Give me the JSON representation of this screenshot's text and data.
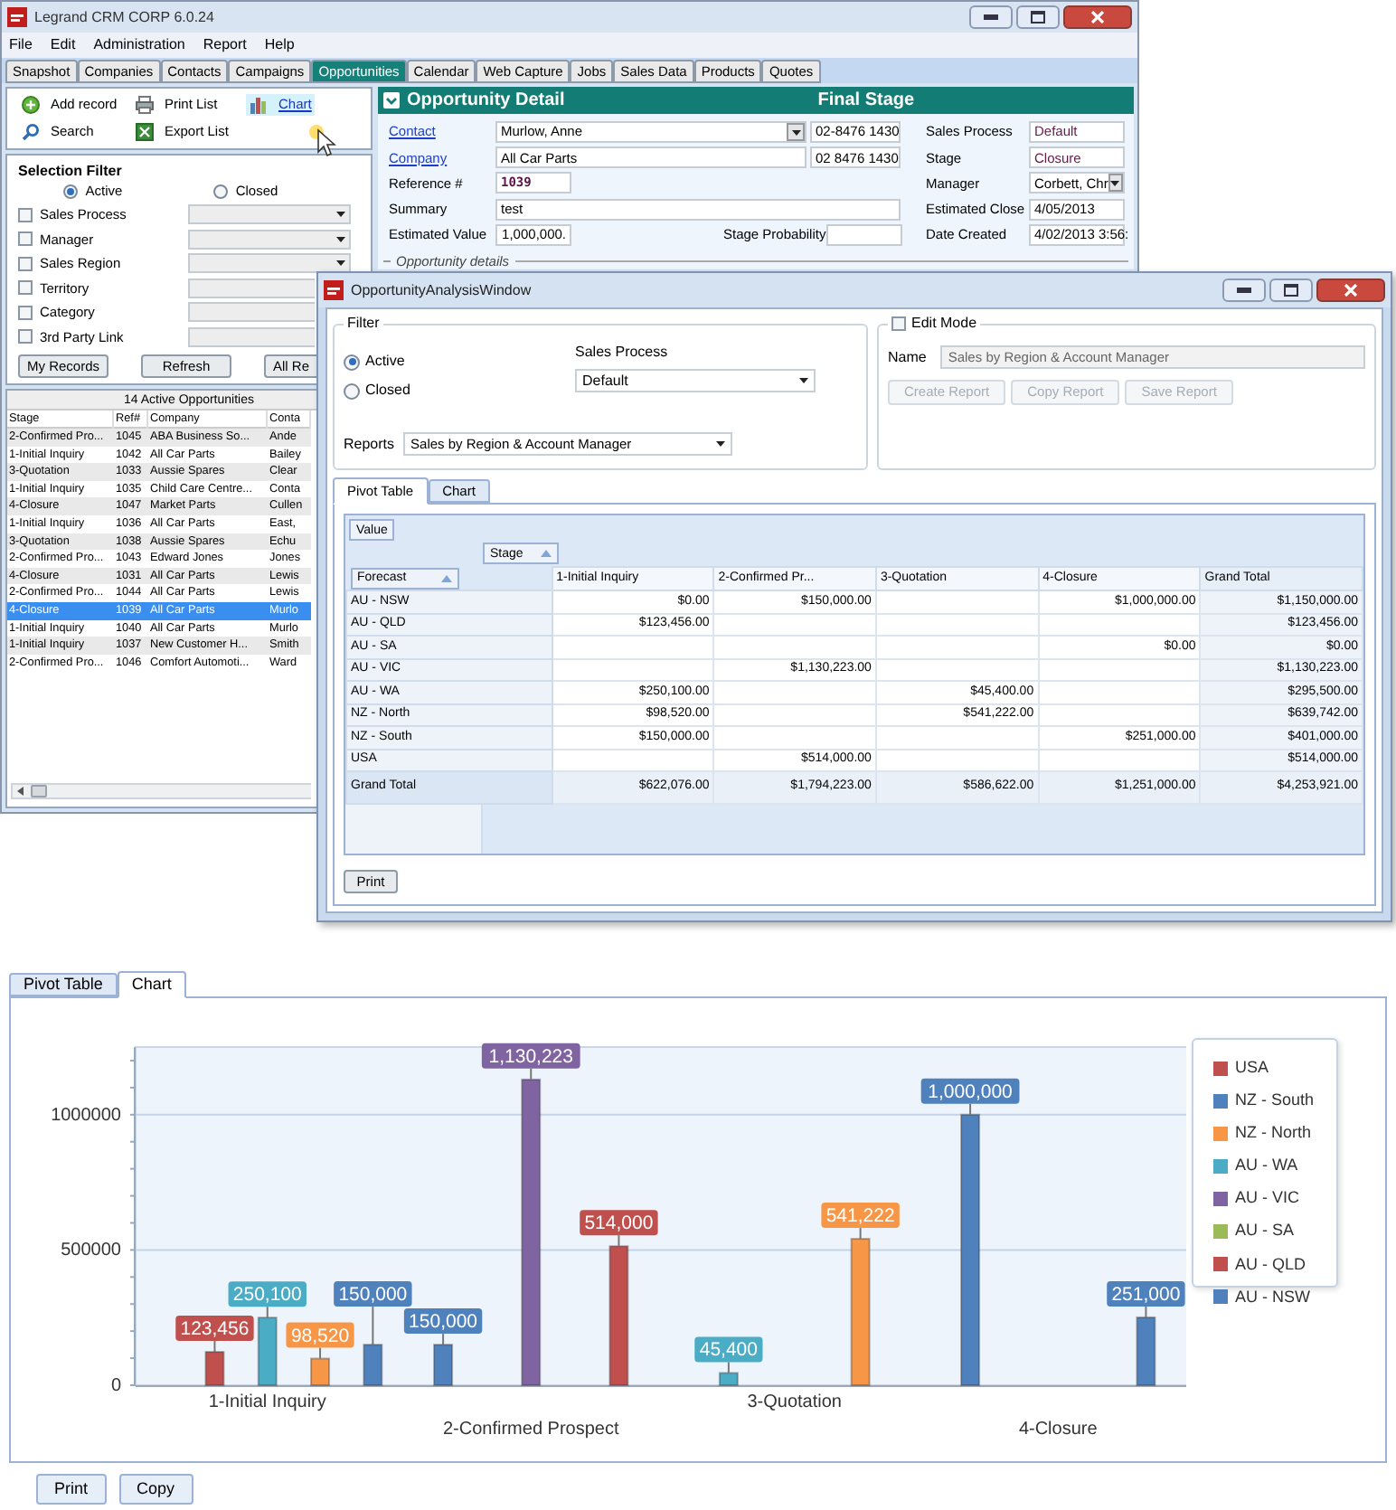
{
  "main_window": {
    "title": "Legrand CRM CORP 6.0.24",
    "menu": [
      "File",
      "Edit",
      "Administration",
      "Report",
      "Help"
    ],
    "tabs": [
      {
        "label": "Snapshot",
        "selected": false
      },
      {
        "label": "Companies",
        "selected": false
      },
      {
        "label": "Contacts",
        "selected": false
      },
      {
        "label": "Campaigns",
        "selected": false
      },
      {
        "label": "Opportunities",
        "selected": true
      },
      {
        "label": "Calendar",
        "selected": false
      },
      {
        "label": "Web Capture",
        "selected": false
      },
      {
        "label": "Jobs",
        "selected": false
      },
      {
        "label": "Sales Data",
        "selected": false
      },
      {
        "label": "Products",
        "selected": false
      },
      {
        "label": "Quotes",
        "selected": false
      }
    ],
    "actions": [
      {
        "label": "Add record",
        "kind": "add",
        "hovered": false
      },
      {
        "label": "Print List",
        "kind": "print",
        "hovered": false
      },
      {
        "label": "Chart",
        "kind": "chart",
        "hovered": true
      },
      {
        "label": "Search",
        "kind": "search",
        "hovered": false
      },
      {
        "label": "Export List",
        "kind": "export",
        "hovered": false
      }
    ],
    "selection_filter": {
      "title": "Selection Filter",
      "status_options": [
        {
          "label": "Active",
          "selected": true
        },
        {
          "label": "Closed",
          "selected": false
        }
      ],
      "filters": [
        {
          "label": "Sales Process",
          "checked": false,
          "kind": "dropdown"
        },
        {
          "label": "Manager",
          "checked": false,
          "kind": "dropdown"
        },
        {
          "label": "Sales Region",
          "checked": false,
          "kind": "dropdown"
        },
        {
          "label": "Territory",
          "checked": false,
          "kind": "text"
        },
        {
          "label": "Category",
          "checked": false,
          "kind": "text"
        },
        {
          "label": "3rd Party Link",
          "checked": false,
          "kind": "text"
        }
      ],
      "buttons": [
        "My Records",
        "Refresh",
        "All Re"
      ]
    },
    "list": {
      "title": "14 Active Opportunities",
      "columns": [
        "Stage",
        "Ref#",
        "Company",
        "Conta"
      ],
      "rows": [
        {
          "cells": [
            "2-Confirmed Pro...",
            "1045",
            "ABA Business So...",
            "Ande"
          ],
          "selected": false
        },
        {
          "cells": [
            "1-Initial Inquiry",
            "1042",
            "All Car Parts",
            "Bailey"
          ],
          "selected": false
        },
        {
          "cells": [
            "3-Quotation",
            "1033",
            "Aussie Spares",
            "Clear"
          ],
          "selected": false
        },
        {
          "cells": [
            "1-Initial Inquiry",
            "1035",
            "Child Care Centre...",
            "Conta"
          ],
          "selected": false
        },
        {
          "cells": [
            "4-Closure",
            "1047",
            "Market Parts",
            "Cullen"
          ],
          "selected": false
        },
        {
          "cells": [
            "1-Initial Inquiry",
            "1036",
            "All Car Parts",
            "East,"
          ],
          "selected": false
        },
        {
          "cells": [
            "3-Quotation",
            "1038",
            "Aussie Spares",
            "Echu"
          ],
          "selected": false
        },
        {
          "cells": [
            "2-Confirmed Pro...",
            "1043",
            "Edward Jones",
            "Jones"
          ],
          "selected": false
        },
        {
          "cells": [
            "4-Closure",
            "1031",
            "All Car Parts",
            "Lewis"
          ],
          "selected": false
        },
        {
          "cells": [
            "2-Confirmed Pro...",
            "1044",
            "All Car Parts",
            "Lewis"
          ],
          "selected": false
        },
        {
          "cells": [
            "4-Closure",
            "1039",
            "All Car Parts",
            "Murlo"
          ],
          "selected": true
        },
        {
          "cells": [
            "1-Initial Inquiry",
            "1040",
            "All Car Parts",
            "Murlo"
          ],
          "selected": false
        },
        {
          "cells": [
            "1-Initial Inquiry",
            "1037",
            "New Customer H...",
            "Smith"
          ],
          "selected": false
        },
        {
          "cells": [
            "2-Confirmed Pro...",
            "1046",
            "Comfort Automoti...",
            "Ward"
          ],
          "selected": false
        }
      ]
    },
    "detail": {
      "title": "Opportunity Detail",
      "banner": "Final Stage",
      "contact": {
        "label": "Contact",
        "value": "Murlow, Anne",
        "phone": "02-8476 1430"
      },
      "company": {
        "label": "Company",
        "value": "All Car Parts",
        "phone": "02 8476 1430"
      },
      "reference": {
        "label": "Reference #",
        "value": "1039"
      },
      "summary": {
        "label": "Summary",
        "value": "test"
      },
      "estimated_value": {
        "label": "Estimated Value",
        "value": "1,000,000."
      },
      "stage_probability": {
        "label": "Stage Probability"
      },
      "side_fields": [
        {
          "label": "Sales Process",
          "value": "Default",
          "kind": "text",
          "read_only": true
        },
        {
          "label": "Stage",
          "value": "Closure",
          "kind": "text",
          "read_only": true
        },
        {
          "label": "Manager",
          "value": "Corbett, Chr",
          "kind": "dropdown",
          "read_only": false
        },
        {
          "label": "Estimated Close",
          "value": "4/05/2013",
          "kind": "text",
          "read_only": false
        },
        {
          "label": "Date Created",
          "value": "4/02/2013 3:56:",
          "kind": "text",
          "read_only": false
        }
      ],
      "section": "Opportunity details"
    }
  },
  "analysis_window": {
    "title": "OpportunityAnalysisWindow",
    "filter": {
      "title": "Filter",
      "status_options": [
        {
          "label": "Active",
          "selected": true
        },
        {
          "label": "Closed",
          "selected": false
        }
      ],
      "sales_process": {
        "label": "Sales Process",
        "value": "Default"
      },
      "reports": {
        "label": "Reports",
        "value": "Sales by Region & Account Manager"
      }
    },
    "edit_mode": {
      "label": "Edit Mode",
      "checked": false,
      "name": {
        "label": "Name",
        "value": "Sales by Region & Account Manager"
      },
      "buttons": [
        {
          "label": "Create Report",
          "disabled": true
        },
        {
          "label": "Copy Report",
          "disabled": true
        },
        {
          "label": "Save Report",
          "disabled": true
        }
      ]
    },
    "tabs": [
      {
        "label": "Pivot Table",
        "selected": true
      },
      {
        "label": "Chart",
        "selected": false
      }
    ],
    "pivot": {
      "value_field": "Value",
      "column_field": "Stage",
      "row_field": "Forecast",
      "columns": [
        "1-Initial Inquiry",
        "2-Confirmed Pr...",
        "3-Quotation",
        "4-Closure",
        "Grand Total"
      ],
      "rows": [
        {
          "label": "AU - NSW",
          "cells": [
            "$0.00",
            "$150,000.00",
            null,
            "$1,000,000.00",
            "$1,150,000.00"
          ]
        },
        {
          "label": "AU - QLD",
          "cells": [
            "$123,456.00",
            null,
            null,
            null,
            "$123,456.00"
          ]
        },
        {
          "label": "AU - SA",
          "cells": [
            null,
            null,
            null,
            "$0.00",
            "$0.00"
          ]
        },
        {
          "label": "AU - VIC",
          "cells": [
            null,
            "$1,130,223.00",
            null,
            null,
            "$1,130,223.00"
          ]
        },
        {
          "label": "AU - WA",
          "cells": [
            "$250,100.00",
            null,
            "$45,400.00",
            null,
            "$295,500.00"
          ]
        },
        {
          "label": "NZ - North",
          "cells": [
            "$98,520.00",
            null,
            "$541,222.00",
            null,
            "$639,742.00"
          ]
        },
        {
          "label": "NZ - South",
          "cells": [
            "$150,000.00",
            null,
            null,
            "$251,000.00",
            "$401,000.00"
          ]
        },
        {
          "label": "USA",
          "cells": [
            null,
            "$514,000.00",
            null,
            null,
            "$514,000.00"
          ]
        }
      ],
      "total_row": {
        "label": "Grand Total",
        "cells": [
          "$622,076.00",
          "$1,794,223.00",
          "$586,622.00",
          "$1,251,000.00",
          "$4,253,921.00"
        ]
      }
    },
    "buttons": [
      "Print"
    ]
  },
  "chart_panel": {
    "tabs": [
      {
        "label": "Pivot Table",
        "selected": false
      },
      {
        "label": "Chart",
        "selected": true
      }
    ],
    "chart_data": {
      "type": "bar",
      "categories": [
        "1-Initial Inquiry",
        "2-Confirmed Prospect",
        "3-Quotation",
        "4-Closure"
      ],
      "series": [
        {
          "name": "AU - NSW",
          "color": "#4f81bd",
          "values": [
            0,
            150000,
            null,
            1000000
          ]
        },
        {
          "name": "AU - QLD",
          "color": "#c0504d",
          "values": [
            123456,
            null,
            null,
            null
          ]
        },
        {
          "name": "AU - SA",
          "color": "#9bbb59",
          "values": [
            null,
            null,
            null,
            0
          ]
        },
        {
          "name": "AU - VIC",
          "color": "#8064a2",
          "values": [
            null,
            1130223,
            null,
            null
          ]
        },
        {
          "name": "AU - WA",
          "color": "#4bacc6",
          "values": [
            250100,
            null,
            45400,
            null
          ]
        },
        {
          "name": "NZ - North",
          "color": "#f79646",
          "values": [
            98520,
            null,
            541222,
            null
          ]
        },
        {
          "name": "NZ - South",
          "color": "#4f81bd",
          "values": [
            150000,
            null,
            null,
            251000
          ]
        },
        {
          "name": "USA",
          "color": "#c0504d",
          "values": [
            null,
            514000,
            null,
            null
          ]
        }
      ],
      "ylim": [
        0,
        1250000
      ],
      "yticks": [
        0,
        500000,
        1000000
      ],
      "value_labels": [
        [
          null,
          "150,000",
          null,
          "1,000,000"
        ],
        [
          "123,456",
          null,
          null,
          null
        ],
        [
          null,
          null,
          null,
          null
        ],
        [
          null,
          "1,130,223",
          null,
          null
        ],
        [
          "250,100",
          null,
          "45,400",
          null
        ],
        [
          "98,520",
          null,
          "541,222",
          null
        ],
        [
          "150,000",
          null,
          null,
          "251,000"
        ],
        [
          null,
          "514,000",
          null,
          null
        ]
      ]
    },
    "buttons": [
      "Print",
      "Copy"
    ]
  }
}
